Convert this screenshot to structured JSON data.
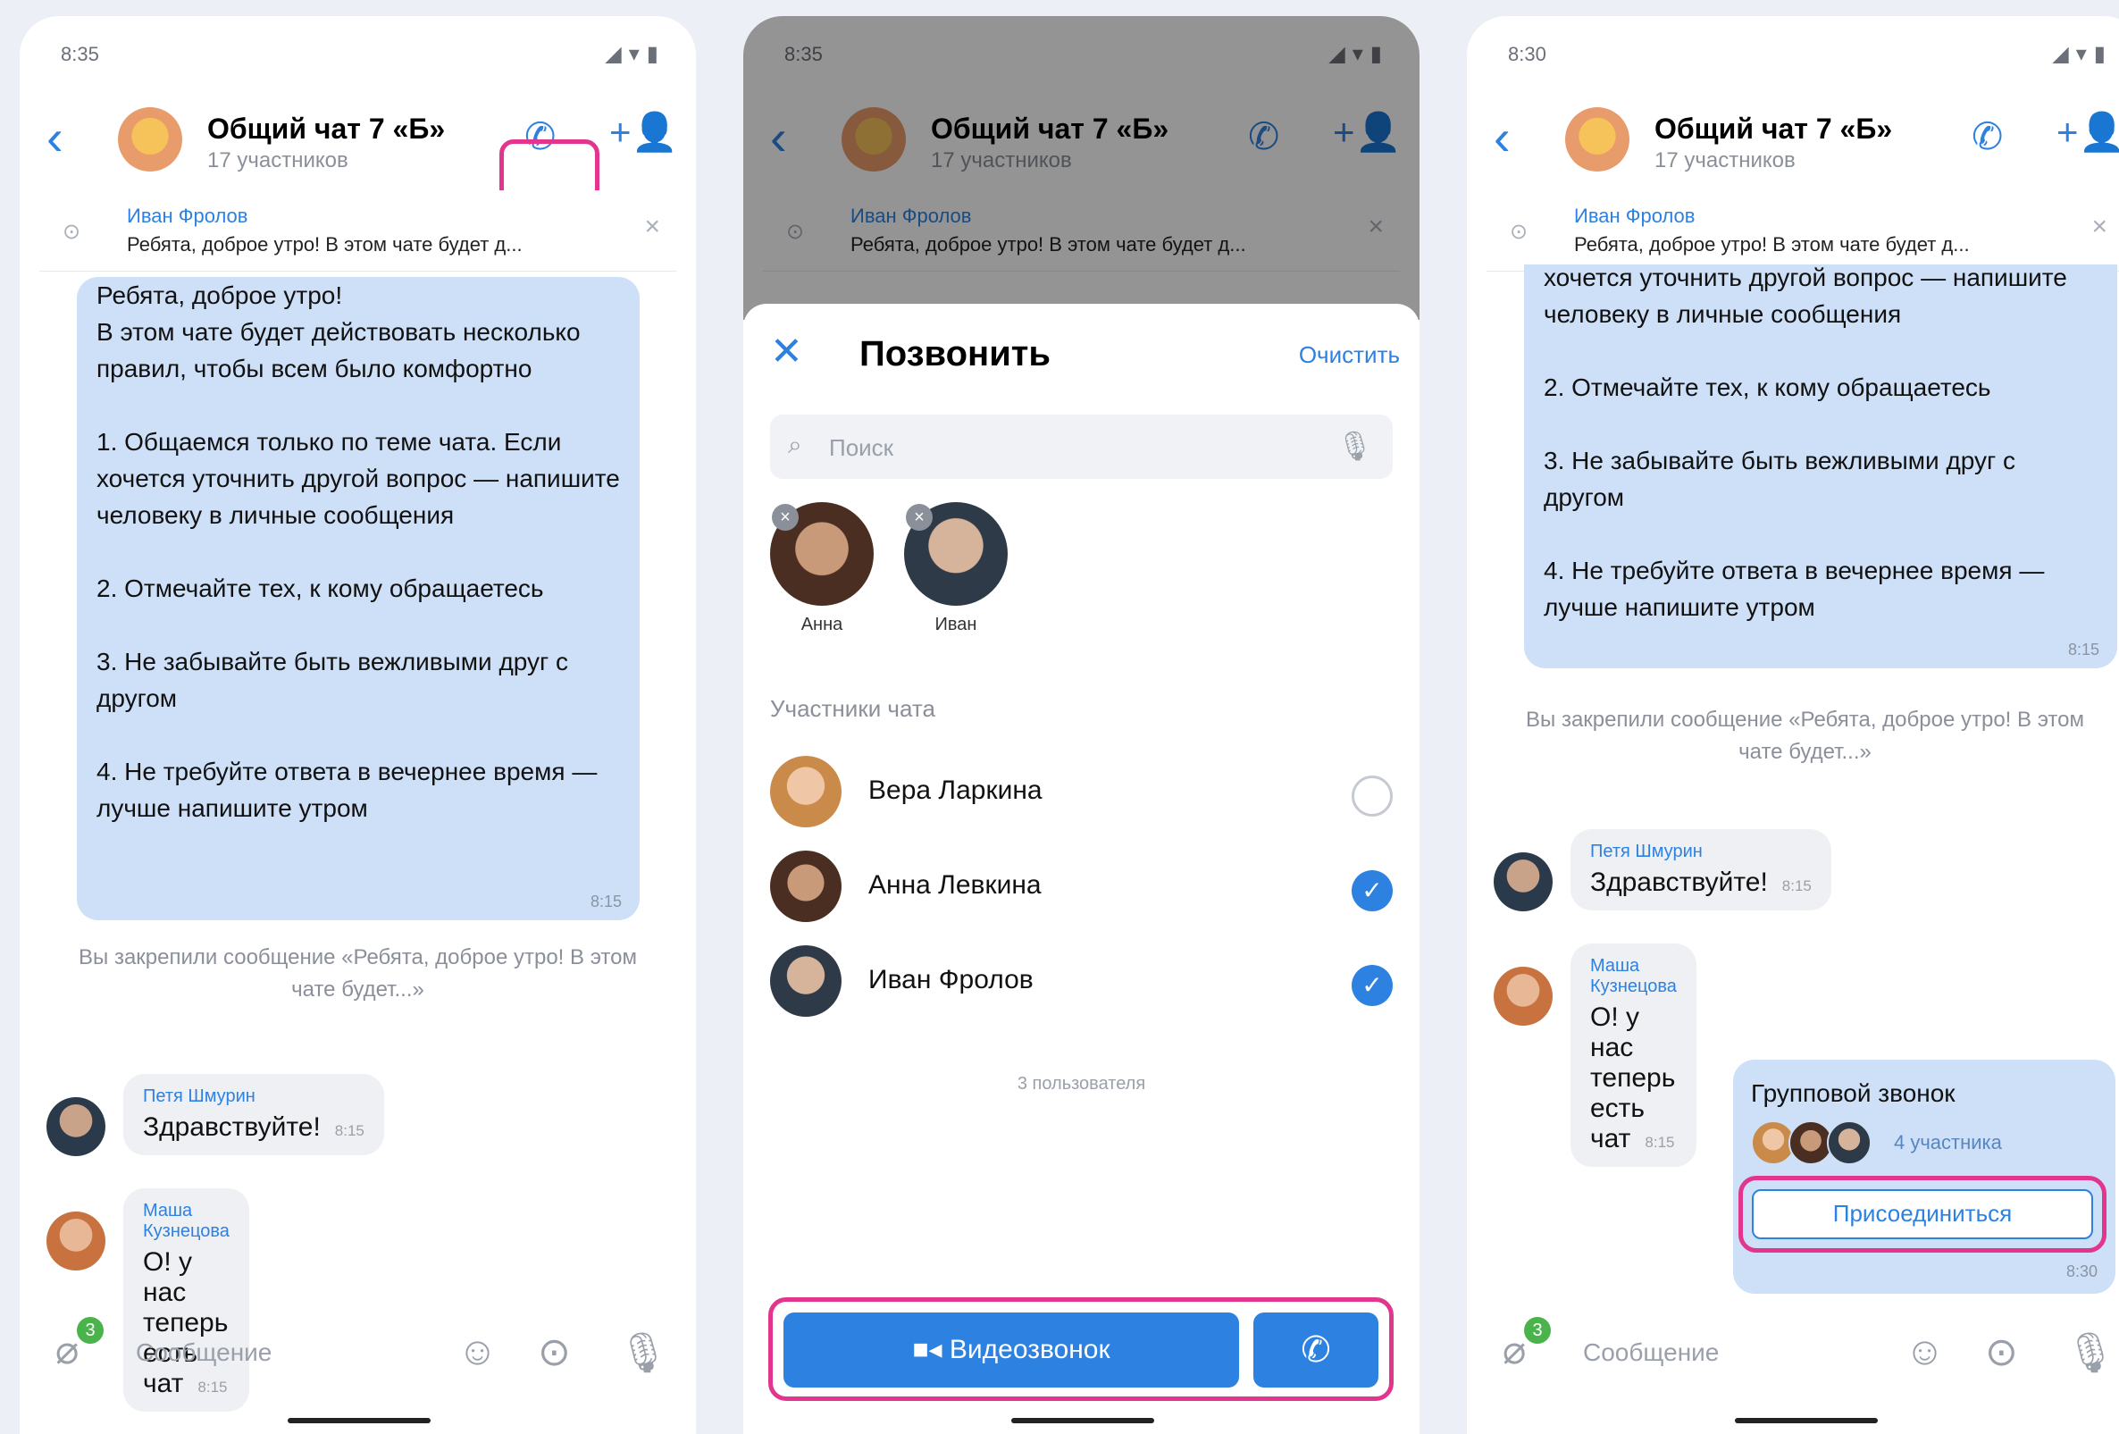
{
  "status": {
    "time1": "8:35",
    "time2": "8:35",
    "time3": "8:30",
    "icons": "◢▾▮"
  },
  "chat": {
    "title": "Общий чат 7 «Б»",
    "subtitle": "17 участников"
  },
  "pinned": {
    "author": "Иван Фролов",
    "text": "Ребята, доброе утро! В этом чате будет д..."
  },
  "rules_message": {
    "text1": "Ребята, доброе утро!\nВ этом чате будет действовать несколько правил, чтобы всем было комфортно\n\n1. Общаемся только по теме чата. Если хочется уточнить другой вопрос — напишите человеку в личные сообщения\n\n2. Отмечайте тех, к кому обращаетесь\n\n3. Не забывайте быть вежливыми друг с другом\n\n4. Не требуйте ответа в вечернее время — лучше напишите утром",
    "text3": "хочется уточнить другой вопрос — напишите человеку в личные сообщения\n\n2. Отмечайте тех, к кому обращаетесь\n\n3. Не забывайте быть вежливыми друг с другом\n\n4. Не требуйте ответа в вечернее время — лучше напишите утром",
    "time": "8:15"
  },
  "system_note": "Вы закрепили сообщение «Ребята, доброе утро! В этом чате будет...»",
  "incoming": [
    {
      "name": "Петя Шмурин",
      "text": "Здравствуйте!",
      "time": "8:15"
    },
    {
      "name": "Маша Кузнецова",
      "text": "О! у нас теперь есть чат",
      "time": "8:15"
    }
  ],
  "input": {
    "placeholder": "Сообщение",
    "badge": "3"
  },
  "call_sheet": {
    "title": "Позвонить",
    "clear": "Очистить",
    "search_placeholder": "Поиск",
    "selected": [
      {
        "name": "Анна"
      },
      {
        "name": "Иван"
      }
    ],
    "section_title": "Участники чата",
    "members": [
      {
        "name": "Вера Ларкина",
        "checked": false
      },
      {
        "name": "Анна Левкина",
        "checked": true
      },
      {
        "name": "Иван Фролов",
        "checked": true
      }
    ],
    "count_text": "3 пользователя",
    "video_button": "Видеозвонок"
  },
  "group_call": {
    "title": "Групповой звонок",
    "count": "4 участника",
    "join": "Присоединиться",
    "time": "8:30"
  },
  "colors": {
    "accent": "#2d81e0",
    "highlight": "#e2358e",
    "bubble": "#cde0f7"
  }
}
